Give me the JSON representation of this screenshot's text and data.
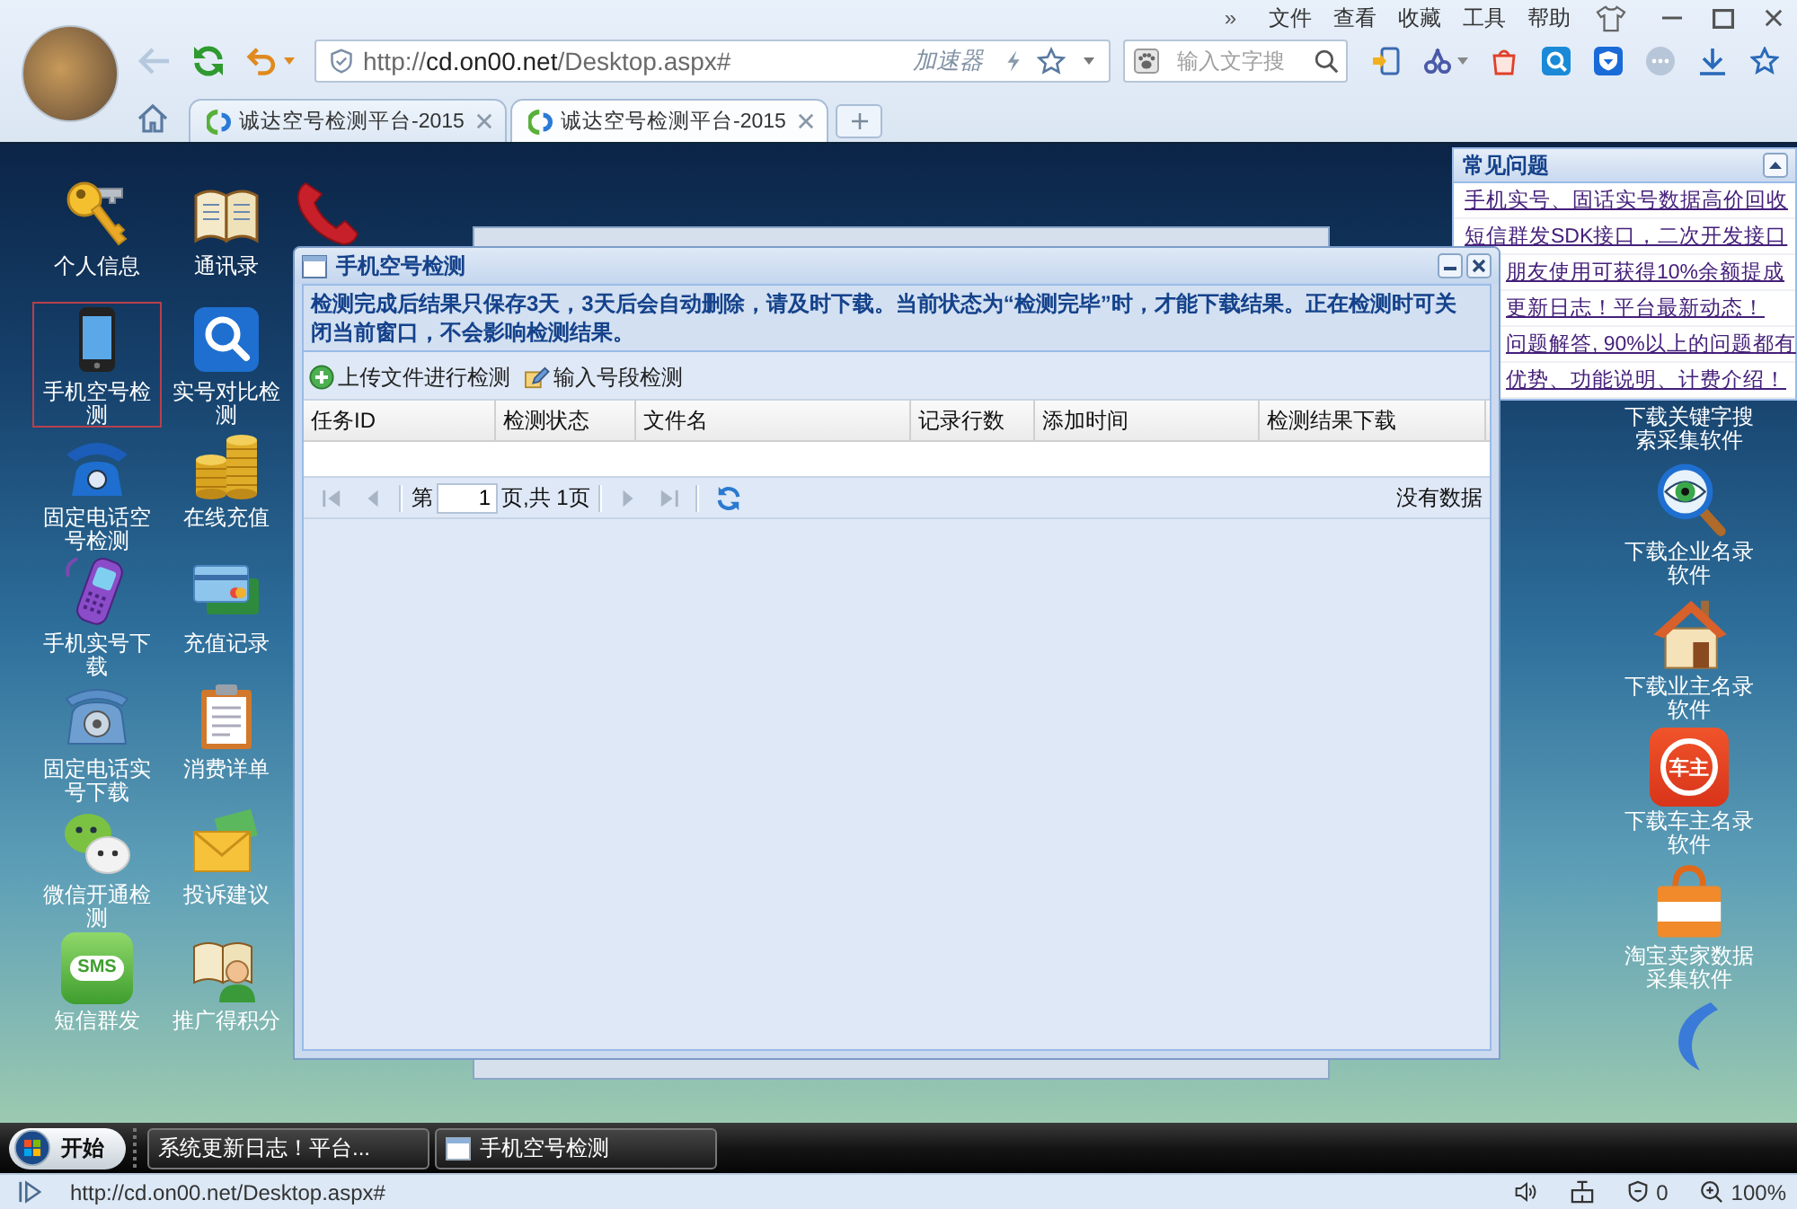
{
  "browser": {
    "menu": {
      "overflow": "»",
      "items": [
        "文件",
        "查看",
        "收藏",
        "工具",
        "帮助"
      ]
    },
    "nav_buttons": [
      {
        "kind": "back",
        "disabled": true
      },
      {
        "kind": "refresh",
        "disabled": false
      },
      {
        "kind": "undo",
        "disabled": false
      }
    ],
    "address": {
      "url_parts": [
        {
          "text": "http://",
          "dim": true
        },
        {
          "text": "cd.on00.net",
          "dim": false
        },
        {
          "text": "/Desktop.aspx#",
          "dim": true
        }
      ],
      "accelerator": "加速器"
    },
    "search": {
      "placeholder": "输入文字搜"
    },
    "tabs": [
      {
        "title": "诚达空号检测平台-2015",
        "selected": false
      },
      {
        "title": "诚达空号检测平台-2015",
        "selected": true
      }
    ]
  },
  "desktop": {
    "icons": [
      {
        "label": "个人信息",
        "selected": false
      },
      {
        "label": "通讯录",
        "selected": false
      },
      {
        "label": "手机空号检测",
        "selected": true
      },
      {
        "label": "实号对比检测",
        "selected": false
      },
      {
        "label": "固定电话空号检测",
        "selected": false
      },
      {
        "label": "在线充值",
        "selected": false
      },
      {
        "label": "手机实号下载",
        "selected": false
      },
      {
        "label": "充值记录",
        "selected": false
      },
      {
        "label": "固定电话实号下载",
        "selected": false
      },
      {
        "label": "消费详单",
        "selected": false
      },
      {
        "label": "微信开通检测",
        "selected": false
      },
      {
        "label": "投诉建议",
        "selected": false
      },
      {
        "label": "短信群发",
        "selected": false,
        "badge": "SMS"
      },
      {
        "label": "推广得积分",
        "selected": false
      }
    ],
    "downloads": [
      {
        "label": "下载关键字搜索采集软件"
      },
      {
        "label": "下载企业名录软件"
      },
      {
        "label": "下载业主名录软件"
      },
      {
        "label": "下载车主名录软件",
        "badge": "车主"
      },
      {
        "label": "淘宝卖家数据采集软件"
      }
    ]
  },
  "faq_panel": {
    "title": "常见问题",
    "links": [
      {
        "text": "手机实号、固话实号数据高价回收",
        "covered": false
      },
      {
        "text": "短信群发SDK接口，二次开发接口",
        "covered": false
      },
      {
        "text": "朋友使用可获得10%余额提成",
        "covered": true
      },
      {
        "text": "更新日志！平台最新动态！",
        "covered": true
      },
      {
        "text": "问题解答, 90%以上的问题都有",
        "covered": true
      },
      {
        "text": "优势、功能说明、计费介绍！",
        "covered": true
      }
    ]
  },
  "dialog": {
    "title": "手机空号检测",
    "notice": "检测完成后结果只保存3天，3天后会自动删除，请及时下载。当前状态为“检测完毕”时，才能下载结果。正在检测时可关闭当前窗口，不会影响检测结果。",
    "toolbar": [
      "上传文件进行检测",
      "输入号段检测"
    ],
    "columns": [
      "任务ID",
      "检测状态",
      "文件名",
      "记录行数",
      "添加时间",
      "检测结果下载"
    ],
    "pager": {
      "nav": [
        {
          "kind": "first",
          "disabled": true
        },
        {
          "kind": "prev",
          "disabled": true
        },
        {
          "kind": "next",
          "disabled": true
        },
        {
          "kind": "last",
          "disabled": true
        }
      ],
      "page_prefix": "第",
      "page_value": "1",
      "page_suffix": "页,共 1页",
      "status": "没有数据"
    }
  },
  "taskbar": {
    "start": "开始",
    "tasks": [
      {
        "title": "系统更新日志！平台...",
        "kind": "page"
      },
      {
        "title": "手机空号检测",
        "kind": "window"
      }
    ]
  },
  "status_bar": {
    "url": "http://cd.on00.net/Desktop.aspx#",
    "blocked_count": "0",
    "zoom": "100%"
  }
}
